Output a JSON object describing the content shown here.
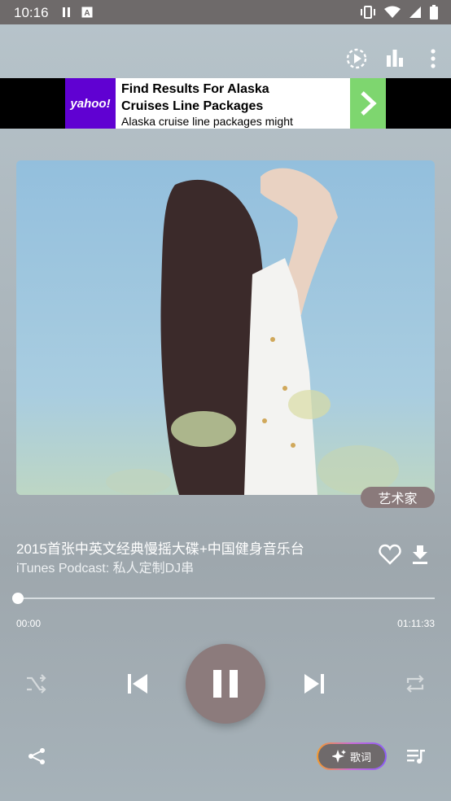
{
  "status_bar": {
    "time": "10:16",
    "icons": [
      "pause-icon",
      "a-notification-icon",
      "vibrate-icon",
      "wifi-icon",
      "signal-icon",
      "battery-icon"
    ]
  },
  "toolbar": {
    "icons": [
      "timer-play-icon",
      "equalizer-icon",
      "more-vertical-icon"
    ]
  },
  "ad": {
    "logo_text": "yahoo!",
    "headline": "Find Results For Alaska\nCruises Line Packages",
    "description": "Alaska cruise line packages might",
    "brand_color": "#6001d2",
    "cta_color": "#7ed66f"
  },
  "album": {
    "artist_badge": "艺术家"
  },
  "track": {
    "title": "2015首张中英文经典慢摇大碟+中国健身音乐台",
    "subtitle": "iTunes Podcast: 私人定制DJ串"
  },
  "progress": {
    "current": "00:00",
    "total": "01:11:33",
    "fraction": 0.0
  },
  "controls": {
    "icons": [
      "shuffle-icon",
      "previous-icon",
      "pause-icon",
      "next-icon",
      "repeat-icon"
    ]
  },
  "bottom": {
    "lyrics_label": "歌词",
    "icons": [
      "share-icon",
      "sparkle-icon",
      "playlist-icon"
    ]
  }
}
